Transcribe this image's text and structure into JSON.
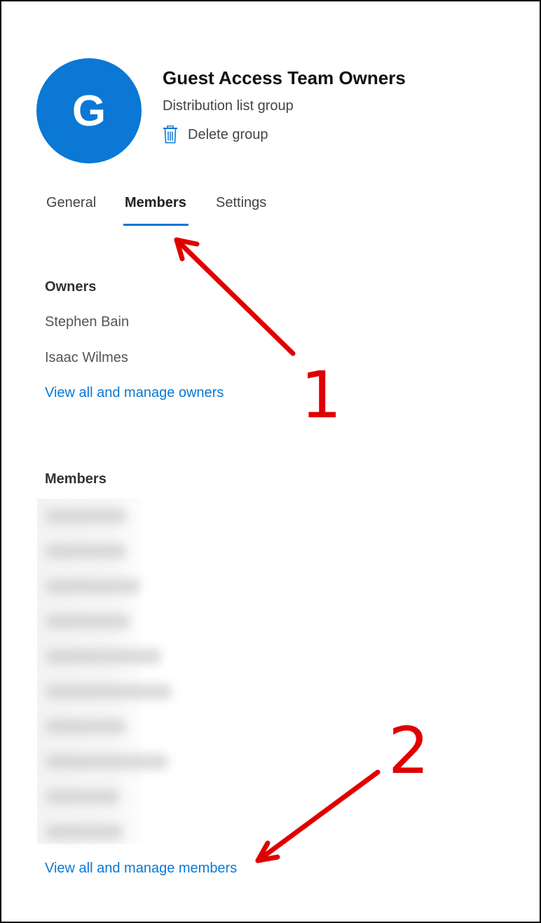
{
  "group": {
    "avatar_letter": "G",
    "name": "Guest Access Team Owners",
    "type": "Distribution list group",
    "delete_label": "Delete group"
  },
  "tabs": [
    {
      "label": "General",
      "active": false
    },
    {
      "label": "Members",
      "active": true
    },
    {
      "label": "Settings",
      "active": false
    }
  ],
  "owners": {
    "heading": "Owners",
    "people": [
      "Stephen Bain",
      "Isaac Wilmes"
    ],
    "manage_link": "View all and manage owners"
  },
  "members": {
    "heading": "Members",
    "blurred_row_count": 10,
    "manage_link": "View all and manage members"
  },
  "annotations": {
    "label_1": "1",
    "label_2": "2",
    "color": "#e00000"
  },
  "colors": {
    "accent": "#0a78d4"
  }
}
